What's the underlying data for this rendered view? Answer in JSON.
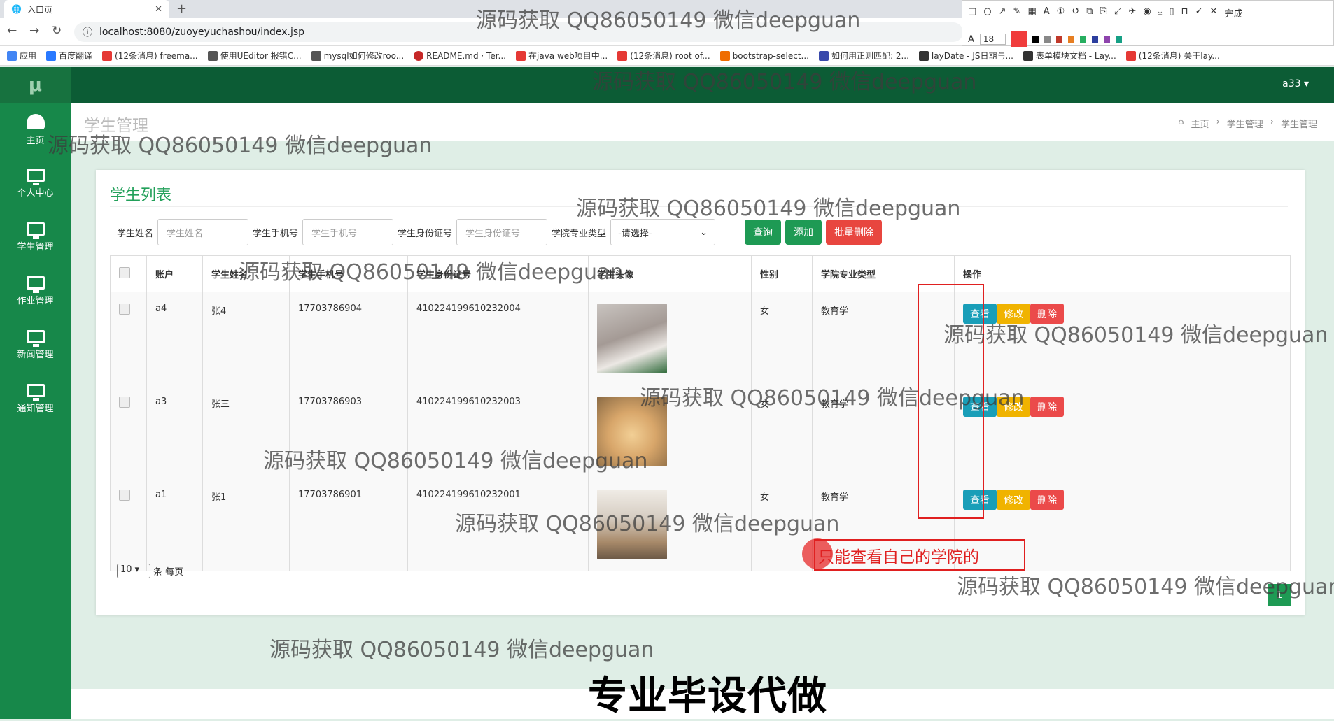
{
  "browser": {
    "tab_title": "入口页",
    "tab_close": "✕",
    "new_tab": "+",
    "url": "localhost:8080/zuoyeyuchashou/index.jsp",
    "bookmarks": [
      "应用",
      "百度翻译",
      "(12条消息) freema...",
      "使用UEditor 报错C...",
      "mysql如何修改roo...",
      "README.md · Ter...",
      "在java web项目中...",
      "(12条消息) root of...",
      "bootstrap-select...",
      "如何用正则匹配: 2...",
      "layDate - JS日期与...",
      "表单模块文档 - Lay...",
      "(12条消息) 关于lay..."
    ]
  },
  "annotation_toolbar": {
    "done_label": "完成",
    "font_size": "18"
  },
  "app": {
    "logo": "μ",
    "user": "a33"
  },
  "sidebar": {
    "items": [
      {
        "label": "主页",
        "icon": "dashboard-icon"
      },
      {
        "label": "个人中心",
        "icon": "monitor-icon"
      },
      {
        "label": "学生管理",
        "icon": "monitor-icon"
      },
      {
        "label": "作业管理",
        "icon": "monitor-icon"
      },
      {
        "label": "新闻管理",
        "icon": "monitor-icon"
      },
      {
        "label": "通知管理",
        "icon": "monitor-icon"
      }
    ]
  },
  "header": {
    "page_title": "学生管理",
    "breadcrumbs": [
      "主页",
      "学生管理",
      "学生管理"
    ]
  },
  "list": {
    "title": "学生列表",
    "filters": {
      "name_label": "学生姓名",
      "name_placeholder": "学生姓名",
      "phone_label": "学生手机号",
      "phone_placeholder": "学生手机号",
      "id_label": "学生身份证号",
      "id_placeholder": "学生身份证号",
      "major_label": "学院专业类型",
      "major_value": "-请选择-"
    },
    "buttons": {
      "query": "查询",
      "add": "添加",
      "batch_delete": "批量删除"
    },
    "columns": [
      "账户",
      "学生姓名",
      "学生手机号",
      "学生身份证号",
      "学生头像",
      "性别",
      "学院专业类型",
      "操作"
    ],
    "rows": [
      {
        "account": "a4",
        "name": "张4",
        "phone": "17703786904",
        "idcard": "410224199610232004",
        "gender": "女",
        "major": "教育学"
      },
      {
        "account": "a3",
        "name": "张三",
        "phone": "17703786903",
        "idcard": "410224199610232003",
        "gender": "女",
        "major": "教育学"
      },
      {
        "account": "a1",
        "name": "张1",
        "phone": "17703786901",
        "idcard": "410224199610232001",
        "gender": "女",
        "major": "教育学"
      }
    ],
    "row_actions": {
      "view": "查看",
      "edit": "修改",
      "delete": "删除"
    },
    "pager": {
      "page_size": "10",
      "per_page_label": "条 每页",
      "current_page": "1"
    }
  },
  "annotations": {
    "note": "只能查看自己的学院的"
  },
  "watermark": "源码获取 QQ86050149 微信deepguan",
  "caption": "专业毕设代做"
}
